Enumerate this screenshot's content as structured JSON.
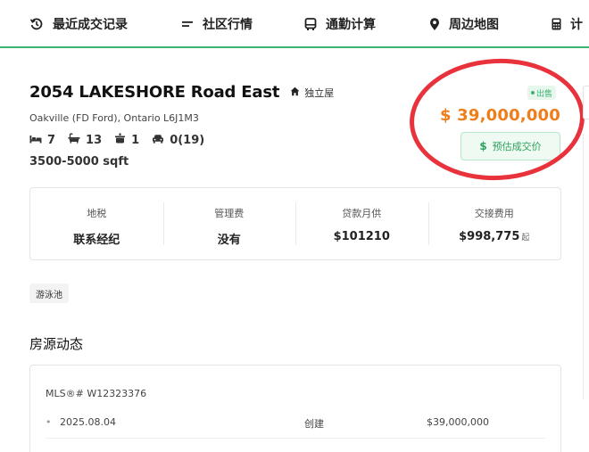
{
  "nav": {
    "items": [
      {
        "label": "最近成交记录",
        "icon": "history-icon"
      },
      {
        "label": "社区行情",
        "icon": "list-icon"
      },
      {
        "label": "通勤计算",
        "icon": "bus-icon"
      },
      {
        "label": "周边地图",
        "icon": "map-pin-icon"
      },
      {
        "label": "计",
        "icon": "calculator-icon"
      }
    ],
    "accent_color": "#3cb371"
  },
  "listing": {
    "title": "2054 LAKESHORE Road East",
    "property_type": "独立屋",
    "address": "Oakville (FD Ford), Ontario L6J1M3",
    "bedrooms": "7",
    "bathrooms": "13",
    "kitchens": "1",
    "parking": "0(19)",
    "sqft": "3500-5000 sqft",
    "status": "出售",
    "price": "$ 39,000,000",
    "estimate_button": {
      "icon": "$",
      "label": "预估成交价"
    },
    "price_color": "#ef7d1a"
  },
  "stats": [
    {
      "label": "地税",
      "value": "联系经纪",
      "suffix": ""
    },
    {
      "label": "管理费",
      "value": "没有",
      "suffix": ""
    },
    {
      "label": "贷款月供",
      "value": "$101210",
      "suffix": ""
    },
    {
      "label": "交接费用",
      "value": "$998,775",
      "suffix": "起"
    }
  ],
  "tags": [
    "游泳池"
  ],
  "history": {
    "section_title": "房源动态",
    "mls": "MLS®# W12323376",
    "rows": [
      {
        "bullet": "•",
        "date": "2025.08.04",
        "event": "创建",
        "amount": "$39,000,000"
      }
    ]
  }
}
